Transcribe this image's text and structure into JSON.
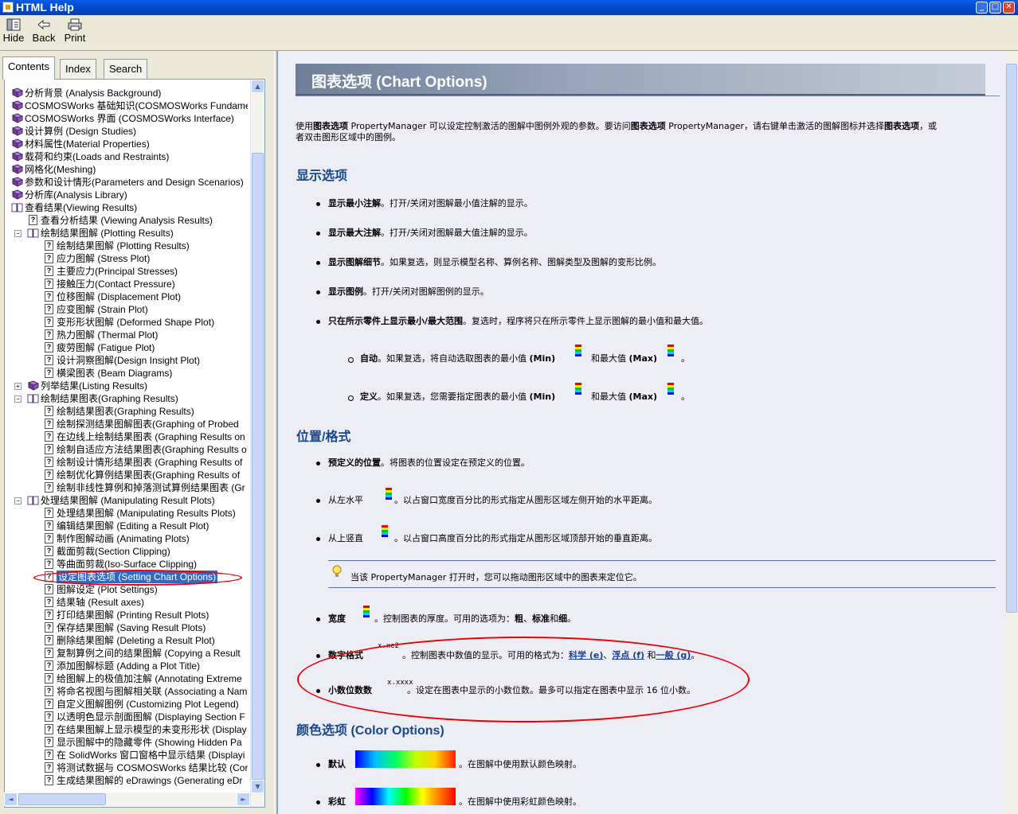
{
  "window": {
    "title": "HTML Help"
  },
  "toolbar": {
    "hide": "Hide",
    "back": "Back",
    "print": "Print"
  },
  "tabs": {
    "contents": "Contents",
    "index": "Index",
    "search": "Search"
  },
  "tree": [
    {
      "label": "分析背景 (Analysis Background)",
      "level": 0,
      "type": "book"
    },
    {
      "label": "COSMOSWorks 基础知识(COSMOSWorks Fundame",
      "level": 0,
      "type": "book"
    },
    {
      "label": "COSMOSWorks 界面 (COSMOSWorks Interface)",
      "level": 0,
      "type": "book"
    },
    {
      "label": "设计算例 (Design Studies)",
      "level": 0,
      "type": "book"
    },
    {
      "label": "材料属性(Material Properties)",
      "level": 0,
      "type": "book"
    },
    {
      "label": "载荷和约束(Loads and Restraints)",
      "level": 0,
      "type": "book"
    },
    {
      "label": "网格化(Meshing)",
      "level": 0,
      "type": "book"
    },
    {
      "label": "参数和设计情形(Parameters and Design Scenarios)",
      "level": 0,
      "type": "book"
    },
    {
      "label": "分析库(Analysis Library)",
      "level": 0,
      "type": "book"
    },
    {
      "label": "查看结果(Viewing Results)",
      "level": 0,
      "type": "open"
    },
    {
      "label": "查看分析结果 (Viewing Analysis Results)",
      "level": 1,
      "type": "page"
    },
    {
      "label": "绘制结果图解 (Plotting Results)",
      "level": 1,
      "type": "open",
      "exp": "−"
    },
    {
      "label": "绘制结果图解 (Plotting Results)",
      "level": 2,
      "type": "page"
    },
    {
      "label": "应力图解 (Stress Plot)",
      "level": 2,
      "type": "page"
    },
    {
      "label": "主要应力(Principal Stresses)",
      "level": 2,
      "type": "page"
    },
    {
      "label": "接触压力(Contact Pressure)",
      "level": 2,
      "type": "page"
    },
    {
      "label": "位移图解 (Displacement Plot)",
      "level": 2,
      "type": "page"
    },
    {
      "label": "应变图解 (Strain Plot)",
      "level": 2,
      "type": "page"
    },
    {
      "label": "变形形状图解 (Deformed Shape Plot)",
      "level": 2,
      "type": "page"
    },
    {
      "label": "热力图解 (Thermal Plot)",
      "level": 2,
      "type": "page"
    },
    {
      "label": "疲劳图解 (Fatigue Plot)",
      "level": 2,
      "type": "page"
    },
    {
      "label": "设计洞察图解(Design Insight Plot)",
      "level": 2,
      "type": "page"
    },
    {
      "label": "横梁图表 (Beam Diagrams)",
      "level": 2,
      "type": "page"
    },
    {
      "label": "列举结果(Listing Results)",
      "level": 1,
      "type": "book",
      "exp": "+"
    },
    {
      "label": "绘制结果图表(Graphing Results)",
      "level": 1,
      "type": "open",
      "exp": "−"
    },
    {
      "label": "绘制结果图表(Graphing Results)",
      "level": 2,
      "type": "page"
    },
    {
      "label": "绘制探测结果图解图表(Graphing of Probed",
      "level": 2,
      "type": "page"
    },
    {
      "label": "在边线上绘制结果图表 (Graphing Results on",
      "level": 2,
      "type": "page"
    },
    {
      "label": "绘制自适应方法结果图表(Graphing Results o",
      "level": 2,
      "type": "page"
    },
    {
      "label": "绘制设计情形结果图表 (Graphing Results of",
      "level": 2,
      "type": "page"
    },
    {
      "label": "绘制优化算例结果图表(Graphing Results of",
      "level": 2,
      "type": "page"
    },
    {
      "label": "绘制非线性算例和掉落测试算例结果图表 (Gr",
      "level": 2,
      "type": "page"
    },
    {
      "label": "处理结果图解 (Manipulating Result Plots)",
      "level": 1,
      "type": "open",
      "exp": "−"
    },
    {
      "label": "处理结果图解 (Manipulating Results Plots)",
      "level": 2,
      "type": "page"
    },
    {
      "label": "编辑结果图解 (Editing a Result Plot)",
      "level": 2,
      "type": "page"
    },
    {
      "label": "制作图解动画 (Animating Plots)",
      "level": 2,
      "type": "page"
    },
    {
      "label": "截面剪裁(Section Clipping)",
      "level": 2,
      "type": "page"
    },
    {
      "label": "等曲面剪裁(Iso-Surface Clipping)",
      "level": 2,
      "type": "page"
    },
    {
      "label": "设定图表选项 (Setting Chart Options)",
      "level": 2,
      "type": "page",
      "selected": true
    },
    {
      "label": "图解设定 (Plot Settings)",
      "level": 2,
      "type": "page"
    },
    {
      "label": "结果轴 (Result axes)",
      "level": 2,
      "type": "page"
    },
    {
      "label": "打印结果图解 (Printing Result Plots)",
      "level": 2,
      "type": "page"
    },
    {
      "label": "保存结果图解 (Saving Result Plots)",
      "level": 2,
      "type": "page"
    },
    {
      "label": "删除结果图解 (Deleting a Result Plot)",
      "level": 2,
      "type": "page"
    },
    {
      "label": "复制算例之间的结果图解 (Copying a Result",
      "level": 2,
      "type": "page"
    },
    {
      "label": "添加图解标题 (Adding a Plot Title)",
      "level": 2,
      "type": "page"
    },
    {
      "label": "给图解上的极值加注解 (Annotating Extreme",
      "level": 2,
      "type": "page"
    },
    {
      "label": "将命名视图与图解相关联 (Associating a Nam",
      "level": 2,
      "type": "page"
    },
    {
      "label": "自定义图解图例 (Customizing Plot Legend)",
      "level": 2,
      "type": "page"
    },
    {
      "label": "以透明色显示剖面图解 (Displaying Section F",
      "level": 2,
      "type": "page"
    },
    {
      "label": "在结果图解上显示模型的未变形形状 (Display",
      "level": 2,
      "type": "page"
    },
    {
      "label": "显示图解中的隐藏零件 (Showing Hidden Pa",
      "level": 2,
      "type": "page"
    },
    {
      "label": "在 SolidWorks 窗口窗格中显示结果 (Displayi",
      "level": 2,
      "type": "page"
    },
    {
      "label": "将测试数据与 COSMOSWorks 结果比较 (Cor",
      "level": 2,
      "type": "page"
    },
    {
      "label": "生成结果图解的 eDrawings (Generating eDr",
      "level": 2,
      "type": "page"
    }
  ],
  "content": {
    "title": "图表选项  (Chart Options)",
    "intro": {
      "p1": "使用",
      "b1": "图表选项",
      "p2": " PropertyManager 可以设定控制激活的图解中图例外观的参数。要访问",
      "b2": "图表选项",
      "p3": " PropertyManager，请右键单击激活的图解图标并选择",
      "b3": "图表选项",
      "p4": "，或",
      "line2": "者双击图形区域中的图例。"
    },
    "display": {
      "heading": "显示选项",
      "items": [
        {
          "term": "显示最小注解",
          "text": "。打开/关闭对图解最小值注解的显示。"
        },
        {
          "term": "显示最大注解",
          "text": "。打开/关闭对图解最大值注解的显示。"
        },
        {
          "term": "显示图解细节",
          "text": "。如果复选，则显示模型名称、算例名称、图解类型及图解的变形比例。"
        },
        {
          "term": "显示图例",
          "text": "。打开/关闭对图解图例的显示。"
        },
        {
          "term": "只在所示零件上显示最小/最大范围",
          "text": "。复选时，程序将只在所示零件上显示图解的最小值和最大值。"
        }
      ],
      "sub": [
        {
          "term": "自动",
          "text": "。如果复选，将自动选取图表的最小值",
          "min": "(Min)",
          "mid": "和最大值",
          "max": "(Max)",
          "end": "。"
        },
        {
          "term": "定义",
          "text": "。如果复选，您需要指定图表的最小值",
          "min": "(Min)",
          "mid": "和最大值",
          "max": "(Max)",
          "end": "。"
        }
      ]
    },
    "position": {
      "heading": "位置/格式",
      "items": [
        {
          "term": "预定义的位置",
          "text": "。将图表的位置设定在预定义的位置。"
        },
        {
          "term": "从左水平",
          "text": "。以占窗口宽度百分比的形式指定从图形区域左侧开始的水平距离。"
        },
        {
          "term": "从上竖直",
          "text": "。以占窗口高度百分比的形式指定从图形区域顶部开始的垂直距离。"
        }
      ],
      "note": "当该 PropertyManager 打开时，您可以拖动图形区域中的图表来定位它。",
      "width": {
        "term": "宽度",
        "text": "。控制图表的厚度。可用的选项为：",
        "opt1": "粗",
        "sep1": "、",
        "opt2": "标准",
        "sep2": "和",
        "opt3": "细",
        "end": "。"
      },
      "numfmt": {
        "term": "数字格式",
        "text": "。控制图表中数值的显示。可用的格式为：",
        "l1": "科学 (e)",
        "sep1": "、",
        "l2": "浮点 (f)",
        "sep2": " 和",
        "l3": "一般 (g)",
        "end": "。",
        "icon": "x.xe2"
      },
      "decimals": {
        "term": "小数位数数",
        "text": "。设定在图表中显示的小数位数。最多可以指定在图表中显示 16 位小数。",
        "icon": "x.xxxx"
      }
    },
    "color": {
      "heading": "颜色选项 (Color Options)",
      "items": [
        {
          "term": "默认",
          "text": "。在图解中使用默认颜色映射。"
        },
        {
          "term": "彩虹",
          "text": "。在图解中使用彩虹颜色映射。"
        }
      ]
    }
  },
  "colors": {
    "titlebar": "#0046c7",
    "selection": "#316ac5",
    "heading": "#17488a",
    "link": "#1c3e94",
    "annotation": "#ee0000"
  }
}
